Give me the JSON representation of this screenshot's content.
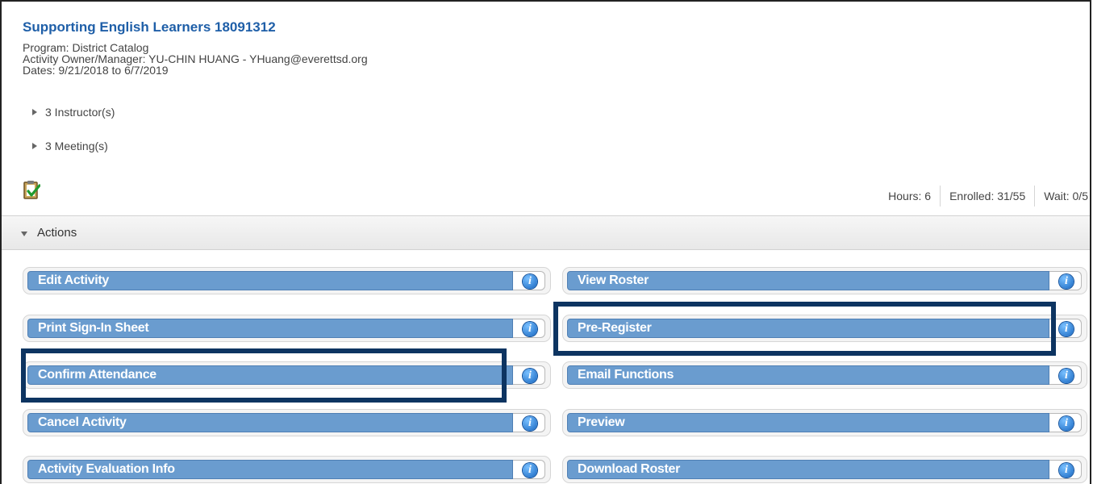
{
  "activity": {
    "title": "Supporting English Learners 18091312",
    "program": "Program: District Catalog",
    "owner": "Activity Owner/Manager: YU-CHIN HUANG  - YHuang@everettsd.org",
    "dates": "Dates: 9/21/2018 to 6/7/2019"
  },
  "sections": {
    "instructors": "3 Instructor(s)",
    "meetings": "3 Meeting(s)",
    "actions": "Actions"
  },
  "stats": {
    "hours": "Hours: 6",
    "enrolled": "Enrolled: 31/55",
    "wait": "Wait: 0/5"
  },
  "buttons": {
    "left": [
      "Edit Activity",
      "Print Sign-In Sheet",
      "Confirm Attendance",
      "Cancel Activity",
      "Activity Evaluation Info"
    ],
    "right": [
      "View Roster",
      "Pre-Register",
      "Email Functions",
      "Preview",
      "Download Roster"
    ]
  },
  "info_label": "i",
  "colors": {
    "title": "#1f5fa8",
    "button": "#6a9ccf",
    "highlight": "#0d3461"
  },
  "icons": {
    "clipboard": "clipboard-check-icon",
    "info": "info-icon",
    "expand": "triangle-right-icon",
    "collapse": "triangle-down-icon"
  }
}
